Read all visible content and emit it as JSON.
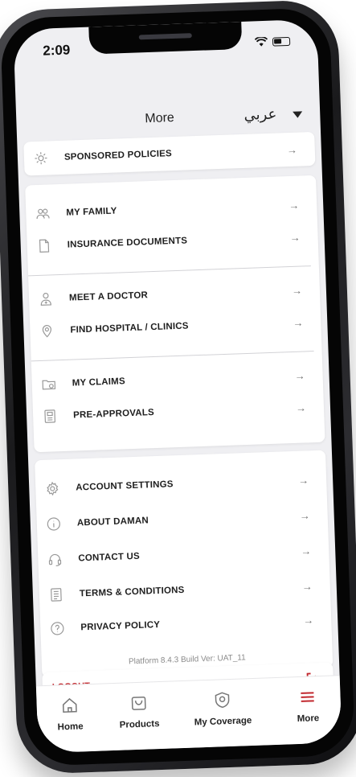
{
  "status": {
    "time": "2:09"
  },
  "header": {
    "title": "More",
    "language": "عربي"
  },
  "sponsored": {
    "label": "SPONSORED POLICIES",
    "icon": "sun-icon"
  },
  "menu_groups": [
    [
      {
        "label": "MY FAMILY",
        "icon": "family-icon"
      },
      {
        "label": "INSURANCE DOCUMENTS",
        "icon": "document-icon"
      }
    ],
    [
      {
        "label": "MEET A DOCTOR",
        "icon": "doctor-icon"
      },
      {
        "label": "FIND HOSPITAL / CLINICS",
        "icon": "location-pin-icon"
      }
    ],
    [
      {
        "label": "MY CLAIMS",
        "icon": "claims-folder-icon"
      },
      {
        "label": "PRE-APPROVALS",
        "icon": "approval-card-icon"
      }
    ]
  ],
  "settings": [
    {
      "label": "ACCOUNT SETTINGS",
      "icon": "gear-icon"
    },
    {
      "label": "ABOUT DAMAN",
      "icon": "info-icon"
    },
    {
      "label": "CONTACT US",
      "icon": "headset-icon"
    },
    {
      "label": "TERMS & CONDITIONS",
      "icon": "terms-icon"
    },
    {
      "label": "PRIVACY POLICY",
      "icon": "question-icon"
    }
  ],
  "build_info": "Platform 8.4.3 Build Ver: UAT_11",
  "logout": {
    "label": "LOGOUT"
  },
  "arrow": "→",
  "tabs": [
    {
      "label": "Home",
      "icon": "home-icon",
      "active": false
    },
    {
      "label": "Products",
      "icon": "products-bag-icon",
      "active": false
    },
    {
      "label": "My Coverage",
      "icon": "shield-icon",
      "active": false
    },
    {
      "label": "More",
      "icon": "hamburger-menu-icon",
      "active": true
    }
  ],
  "colors": {
    "accent": "#c1272d",
    "background": "#efeff2",
    "text": "#1e1e1e"
  }
}
